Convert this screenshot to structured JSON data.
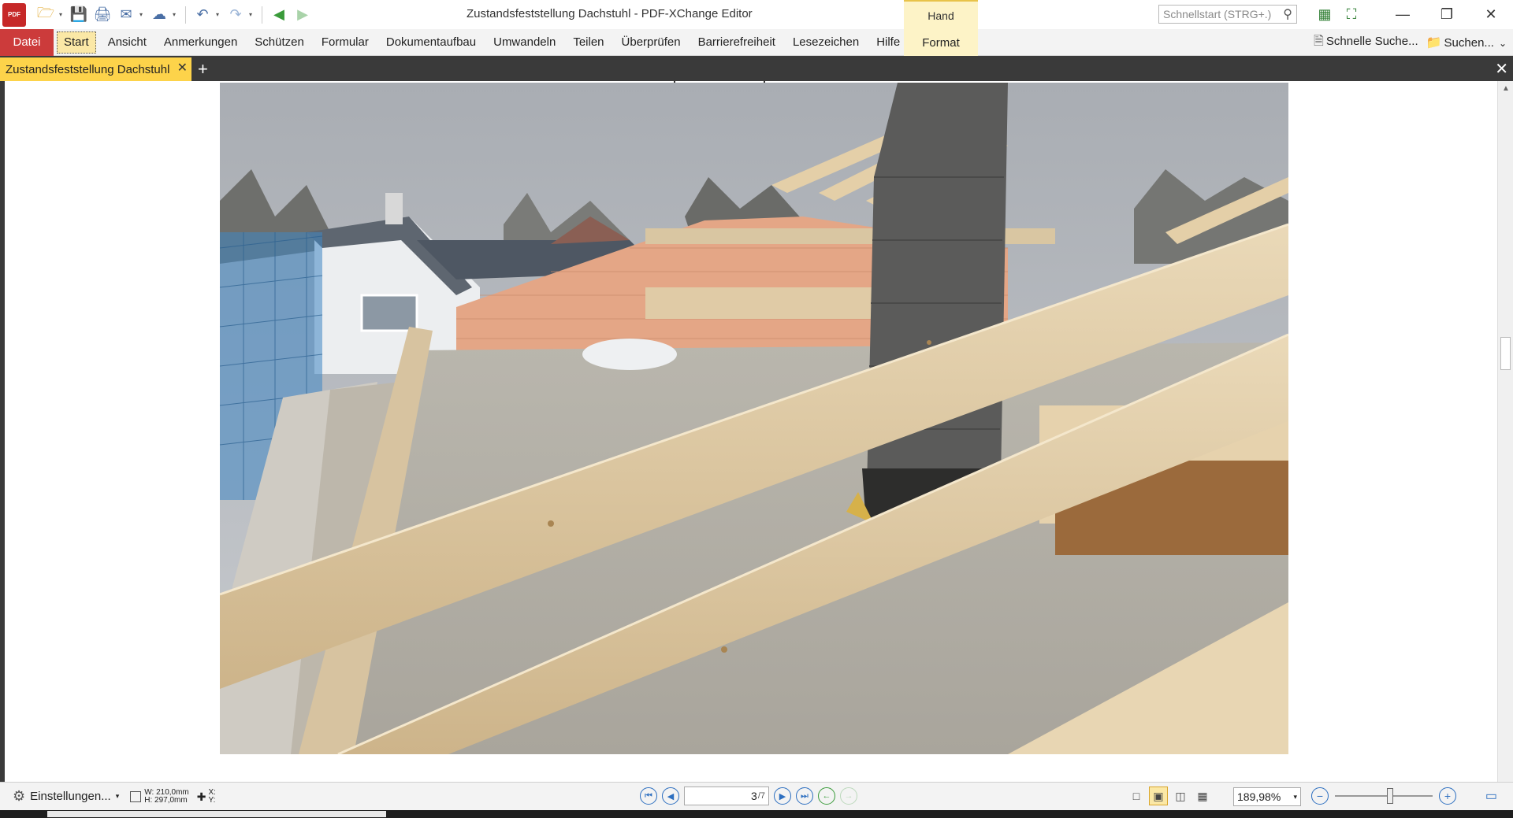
{
  "titlebar": {
    "app_logo": "PDF",
    "title": "Zustandsfeststellung Dachstuhl - PDF-XChange Editor",
    "context_tab": "Hand",
    "quickstart_placeholder": "Schnellstart (STRG+.)"
  },
  "menu": {
    "file": "Datei",
    "items": [
      "Start",
      "Ansicht",
      "Anmerkungen",
      "Schützen",
      "Formular",
      "Dokumentaufbau",
      "Umwandeln",
      "Teilen",
      "Überprüfen",
      "Barrierefreiheit",
      "Lesezeichen",
      "Hilfe"
    ],
    "context_item": "Format",
    "quick_search": "Schnelle Suche...",
    "search": "Suchen..."
  },
  "tabs": {
    "document_tab": "Zustandsfeststellung Dachstuhl"
  },
  "statusbar": {
    "settings": "Einstellungen...",
    "width": "W: 210,0mm",
    "height": "H: 297,0mm",
    "x": "X:",
    "y": "Y:",
    "page_current": "3",
    "page_total": "/7",
    "zoom": "189,98%"
  },
  "colors": {
    "datei_bg": "#cc3b3b",
    "tab_active": "#fdd34a",
    "context_tab_bg": "#fdf3c7",
    "dark_bar": "#3a3a3a"
  },
  "icons": [
    "pdf-logo-icon",
    "open-folder-icon",
    "save-icon",
    "print-icon",
    "email-icon",
    "scan-icon",
    "undo-icon",
    "redo-icon",
    "back-icon",
    "forward-icon",
    "search-icon",
    "gear-icon",
    "first-page-icon",
    "prev-page-icon",
    "next-page-icon",
    "last-page-icon",
    "zoom-out-icon",
    "zoom-in-icon"
  ]
}
